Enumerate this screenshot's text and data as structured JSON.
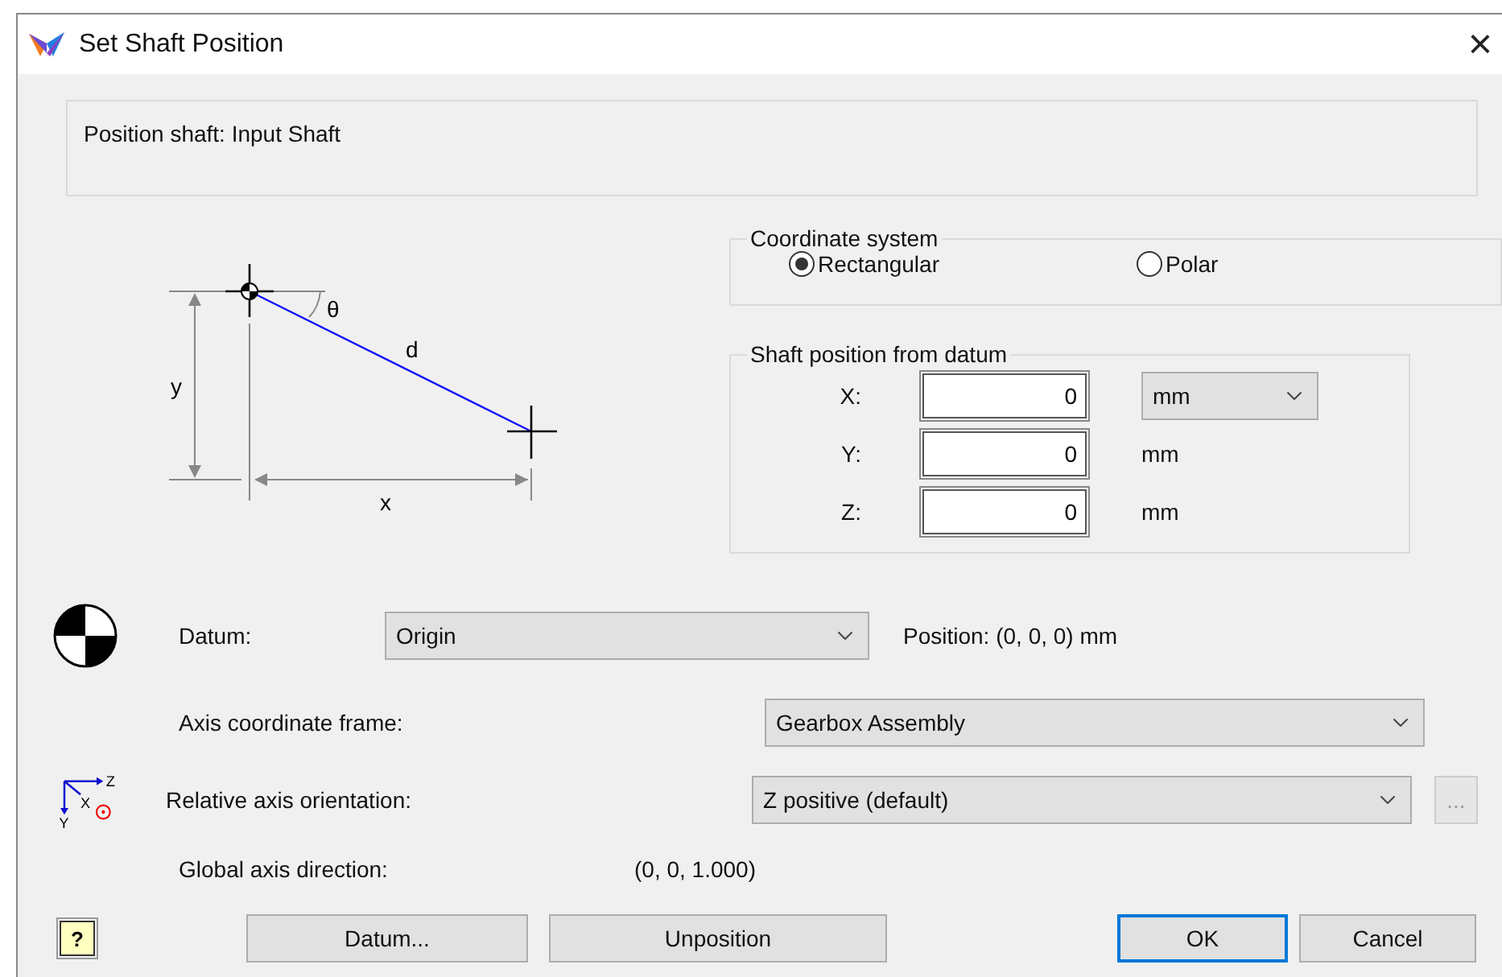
{
  "window": {
    "title": "Set Shaft Position",
    "close": "×"
  },
  "info_text": "Position shaft: Input Shaft",
  "diagram": {
    "y_label": "y",
    "x_label": "x",
    "d_label": "d",
    "angle_label": "θ"
  },
  "coordinate_system": {
    "title": "Coordinate system",
    "options": [
      {
        "label": "Rectangular",
        "selected": true
      },
      {
        "label": "Polar",
        "selected": false
      }
    ]
  },
  "shaft_position": {
    "title": "Shaft position from datum",
    "fields": [
      {
        "label": "X:",
        "value": "0",
        "unit": "mm",
        "kind": "select"
      },
      {
        "label": "Y:",
        "value": "0",
        "unit": "mm",
        "kind": "text"
      },
      {
        "label": "Z:",
        "value": "0",
        "unit": "mm",
        "kind": "text"
      }
    ]
  },
  "datum": {
    "label": "Datum:",
    "value": "Origin",
    "position": "Position: (0, 0, 0) mm"
  },
  "axis_frame": {
    "label": "Axis coordinate frame:",
    "value": "Gearbox Assembly"
  },
  "relative_orientation": {
    "label": "Relative axis orientation:",
    "value": "Z positive (default)",
    "more_button": "...",
    "icon_labels": [
      "Z",
      "X",
      "Y"
    ]
  },
  "global_direction": {
    "label": "Global axis direction:",
    "value": "(0, 0, 1.000)"
  },
  "help_button": "?",
  "buttons": [
    {
      "label": "Datum...",
      "default": false
    },
    {
      "label": "Unposition",
      "default": false
    },
    {
      "label": "OK",
      "default": true
    },
    {
      "label": "Cancel",
      "default": false
    }
  ]
}
